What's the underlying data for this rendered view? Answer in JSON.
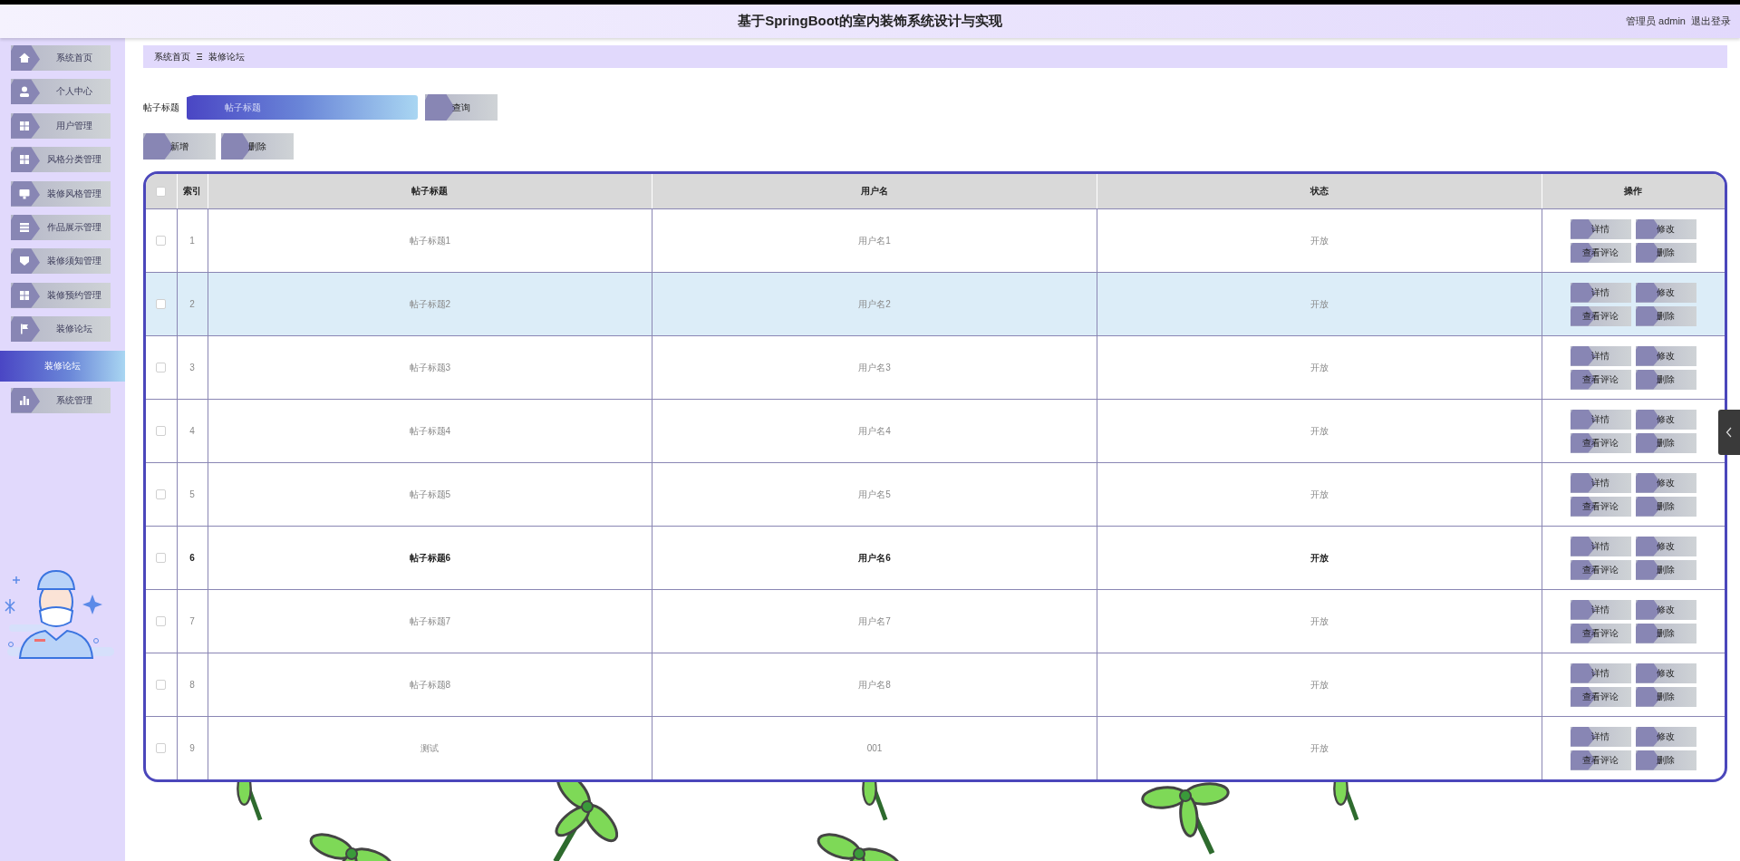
{
  "header": {
    "title": "基于SpringBoot的室内装饰系统设计与实现",
    "user": "管理员 admin",
    "logout": "退出登录"
  },
  "sidebar": {
    "items": [
      {
        "label": "系统首页"
      },
      {
        "label": "个人中心"
      },
      {
        "label": "用户管理"
      },
      {
        "label": "风格分类管理"
      },
      {
        "label": "装修风格管理"
      },
      {
        "label": "作品展示管理"
      },
      {
        "label": "装修须知管理"
      },
      {
        "label": "装修预约管理"
      },
      {
        "label": "装修论坛",
        "children": [
          {
            "label": "装修论坛",
            "selected": true
          }
        ]
      },
      {
        "label": "系统管理"
      }
    ]
  },
  "breadcrumb": [
    "系统首页",
    "装修论坛"
  ],
  "search": {
    "label": "帖子标题",
    "placeholder": "帖子标题",
    "button": "查询"
  },
  "actions": [
    "新增",
    "删除"
  ],
  "table": {
    "all_checked": false,
    "columns": [
      "索引",
      "帖子标题",
      "用户名",
      "状态",
      "操作"
    ],
    "rows": [
      {
        "index": "1",
        "title": "帖子标题1",
        "user": "用户名1",
        "status": "开放",
        "checked": false,
        "highlighted": false,
        "hovered": false,
        "buttons": [
          "详情",
          "修改",
          "查看评论",
          "删除"
        ]
      },
      {
        "index": "2",
        "title": "帖子标题2",
        "user": "用户名2",
        "status": "开放",
        "checked": false,
        "highlighted": true,
        "hovered": false,
        "buttons": [
          "详情",
          "修改",
          "查看评论",
          "删除"
        ]
      },
      {
        "index": "3",
        "title": "帖子标题3",
        "user": "用户名3",
        "status": "开放",
        "checked": false,
        "highlighted": false,
        "hovered": false,
        "buttons": [
          "详情",
          "修改",
          "查看评论",
          "删除"
        ]
      },
      {
        "index": "4",
        "title": "帖子标题4",
        "user": "用户名4",
        "status": "开放",
        "checked": false,
        "highlighted": false,
        "hovered": false,
        "buttons": [
          "详情",
          "修改",
          "查看评论",
          "删除"
        ]
      },
      {
        "index": "5",
        "title": "帖子标题5",
        "user": "用户名5",
        "status": "开放",
        "checked": false,
        "highlighted": false,
        "hovered": false,
        "buttons": [
          "详情",
          "修改",
          "查看评论",
          "删除"
        ]
      },
      {
        "index": "6",
        "title": "帖子标题6",
        "user": "用户名6",
        "status": "开放",
        "checked": false,
        "highlighted": false,
        "hovered": true,
        "buttons": [
          "详情",
          "修改",
          "查看评论",
          "删除"
        ]
      },
      {
        "index": "7",
        "title": "帖子标题7",
        "user": "用户名7",
        "status": "开放",
        "checked": false,
        "highlighted": false,
        "hovered": false,
        "buttons": [
          "详情",
          "修改",
          "查看评论",
          "删除"
        ]
      },
      {
        "index": "8",
        "title": "帖子标题8",
        "user": "用户名8",
        "status": "开放",
        "checked": false,
        "highlighted": false,
        "hovered": false,
        "buttons": [
          "详情",
          "修改",
          "查看评论",
          "删除"
        ]
      },
      {
        "index": "9",
        "title": "测试",
        "user": "001",
        "status": "开放",
        "checked": false,
        "highlighted": false,
        "hovered": false,
        "buttons": [
          "详情",
          "修改",
          "查看评论",
          "删除"
        ]
      }
    ]
  }
}
